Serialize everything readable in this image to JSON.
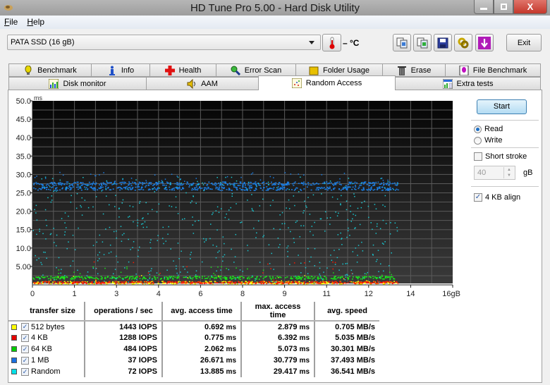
{
  "window": {
    "title": "HD Tune Pro 5.00 - Hard Disk Utility",
    "minimize_glyph": "—",
    "restore_glyph": "❐",
    "close_glyph": "X"
  },
  "menu": [
    {
      "label": "File",
      "accel": "F",
      "rest": "ile"
    },
    {
      "label": "Help",
      "accel": "H",
      "rest": "elp"
    }
  ],
  "toolbar": {
    "drive": "PATA SSD (16 gB)",
    "temperature": "– °C",
    "exit_label": "Exit",
    "icons": [
      "copy-text-icon",
      "copy-screenshot-icon",
      "save-icon",
      "options-icon",
      "update-icon"
    ]
  },
  "tabs": {
    "row1": [
      {
        "label": "Benchmark",
        "icon": "benchmark-icon"
      },
      {
        "label": "Info",
        "icon": "info-icon"
      },
      {
        "label": "Health",
        "icon": "health-icon"
      },
      {
        "label": "Error Scan",
        "icon": "error-scan-icon"
      },
      {
        "label": "Folder Usage",
        "icon": "folder-icon"
      },
      {
        "label": "Erase",
        "icon": "erase-icon"
      },
      {
        "label": "File Benchmark",
        "icon": "file-benchmark-icon"
      }
    ],
    "row2": [
      {
        "label": "Disk monitor",
        "icon": "disk-monitor-icon"
      },
      {
        "label": "AAM",
        "icon": "speaker-icon"
      },
      {
        "label": "Random Access",
        "icon": "random-access-icon",
        "active": true
      },
      {
        "label": "Extra tests",
        "icon": "extra-tests-icon"
      }
    ]
  },
  "controls": {
    "start_label": "Start",
    "read_label": "Read",
    "write_label": "Write",
    "mode": "Read",
    "short_stroke_label": "Short stroke",
    "short_stroke_checked": false,
    "short_stroke_value": "40",
    "short_stroke_unit": "gB",
    "align_label": "4 KB align",
    "align_checked": true
  },
  "chart_data": {
    "type": "scatter",
    "title": "",
    "ylabel": "ms",
    "xlabel": "gB",
    "ylim": [
      0,
      50
    ],
    "xlim": [
      0,
      16
    ],
    "y_ticks": [
      "50.0",
      "45.0",
      "40.0",
      "35.0",
      "30.0",
      "25.0",
      "20.0",
      "15.0",
      "10.0",
      "5.00"
    ],
    "y_tick_values": [
      50,
      45,
      40,
      35,
      30,
      25,
      20,
      15,
      10,
      5
    ],
    "x_ticks": [
      "0",
      "1",
      "3",
      "4",
      "6",
      "8",
      "9",
      "11",
      "12",
      "14",
      "16gB"
    ],
    "x_tick_values": [
      0,
      1.6,
      3.2,
      4.8,
      6.4,
      8,
      9.6,
      11.2,
      12.8,
      14.4,
      16
    ],
    "grid": true,
    "data_end_gb": 13.9,
    "series": [
      {
        "name": "512 bytes",
        "color": "#ffff00",
        "band_ms": [
          0.7
        ],
        "spread_ms": 0.4,
        "max_ms": 2.879
      },
      {
        "name": "4 KB",
        "color": "#ff1a00",
        "band_ms": [
          0.78
        ],
        "spread_ms": 0.3,
        "max_ms": 6.392
      },
      {
        "name": "64 KB",
        "color": "#19e619",
        "band_ms": [
          2.06
        ],
        "spread_ms": 0.4,
        "max_ms": 5.073
      },
      {
        "name": "1 MB",
        "color": "#1a7fe6",
        "band_ms": [
          26.3,
          27.6
        ],
        "spread_ms": 0.5,
        "max_ms": 30.779
      },
      {
        "name": "Random",
        "color": "#19c8d2",
        "band_ms": [],
        "spread_ms": 0,
        "min_ms": 0.7,
        "max_ms": 29.417,
        "scatter": true
      }
    ]
  },
  "results": {
    "headers": [
      "transfer size",
      "operations / sec",
      "avg. access time",
      "max. access time",
      "avg. speed"
    ],
    "rows": [
      {
        "color": "#ffff00",
        "checked": true,
        "size": "512 bytes",
        "iops": "1443 IOPS",
        "avg": "0.692",
        "max": "2.879",
        "speed": "0.705 MB/s"
      },
      {
        "color": "#e60000",
        "checked": true,
        "size": "4 KB",
        "iops": "1288 IOPS",
        "avg": "0.775",
        "max": "6.392",
        "speed": "5.035 MB/s"
      },
      {
        "color": "#00cc00",
        "checked": true,
        "size": "64 KB",
        "iops": "484 IOPS",
        "avg": "2.062",
        "max": "5.073",
        "speed": "30.301 MB/s"
      },
      {
        "color": "#1a6fe0",
        "checked": true,
        "size": "1 MB",
        "iops": "37 IOPS",
        "avg": "26.671",
        "max": "30.779",
        "speed": "37.493 MB/s"
      },
      {
        "color": "#00e0e8",
        "checked": true,
        "size": "Random",
        "iops": "72 IOPS",
        "avg": "13.885",
        "max": "29.417",
        "speed": "36.541 MB/s"
      }
    ],
    "time_unit": "ms"
  }
}
